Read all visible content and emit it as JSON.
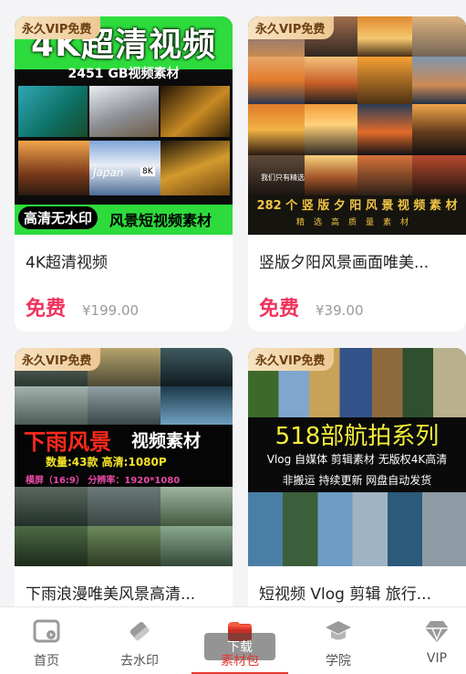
{
  "badge_text": "永久VIP免费",
  "cards": [
    {
      "title": "4K超清视频",
      "price": "免费",
      "original_price": "¥199.00",
      "thumb_text": {
        "headline": "4K超清视频",
        "sub": "2451 GB视频素材",
        "pill": "高清无水印",
        "bottom": "风景短视频素材",
        "japan": "Japan",
        "k8": "8K"
      }
    },
    {
      "title": "竖版夕阳风景画面唯美...",
      "price": "免费",
      "original_price": "¥39.00",
      "thumb_text": {
        "small": "我们只有精选",
        "caption": "282 个 竖 版 夕 阳 风 景 视 频 素 材",
        "caption2": "精选高质量素材"
      }
    },
    {
      "title": "下雨浪漫唯美风景高清...",
      "price": "",
      "original_price": "",
      "thumb_text": {
        "headline": "下雨风景",
        "headline2": "视频素材",
        "line2": "数量:43款  高清:1080P",
        "line3": "横屏（16:9）  分辨率：1920*1080"
      }
    },
    {
      "title": "短视频 Vlog 剪辑 旅行...",
      "price": "",
      "original_price": "",
      "thumb_text": {
        "headline": "518部航拍系列",
        "line2": "Vlog 自媒体 剪辑素材 无版权4K高清",
        "line3": "非搬运 持续更新 网盘自动发货"
      }
    }
  ],
  "nav": {
    "items": [
      {
        "label": "首页",
        "icon": "home-icon"
      },
      {
        "label": "去水印",
        "icon": "eraser-icon"
      },
      {
        "label": "素材包",
        "icon": "material-pack-icon",
        "overlay": "下载"
      },
      {
        "label": "学院",
        "icon": "graduation-cap-icon"
      },
      {
        "label": "VIP",
        "icon": "diamond-icon"
      }
    ],
    "active_color": "#e23a2f"
  },
  "colors": {
    "price": "#f0335d",
    "badge_bg": "#ecc893"
  }
}
